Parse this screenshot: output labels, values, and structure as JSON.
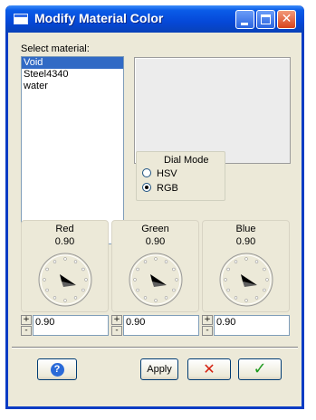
{
  "window": {
    "title": "Modify Material Color"
  },
  "materials": {
    "label": "Select material:",
    "items": [
      "Void",
      "Steel4340",
      "water"
    ],
    "selected": "Void"
  },
  "dial_mode": {
    "title": "Dial Mode",
    "options": [
      "HSV",
      "RGB"
    ],
    "selected": "RGB"
  },
  "dials": [
    {
      "name": "Red",
      "value": "0.90",
      "field": "0.90"
    },
    {
      "name": "Green",
      "value": "0.90",
      "field": "0.90"
    },
    {
      "name": "Blue",
      "value": "0.90",
      "field": "0.90"
    }
  ],
  "spinner": {
    "up": "+",
    "down": "-"
  },
  "buttons": {
    "help": "?",
    "apply": "Apply",
    "cancel": "✕",
    "ok": "✓"
  },
  "colors": {
    "title_bar": "#0548d8",
    "dialog_bg": "#ece9d8",
    "selection": "#316ac5",
    "cancel_red": "#d42010",
    "ok_green": "#1f9a1f"
  },
  "icons": {
    "help": "help-icon",
    "cancel": "cancel-x-icon",
    "ok": "checkmark-icon"
  }
}
